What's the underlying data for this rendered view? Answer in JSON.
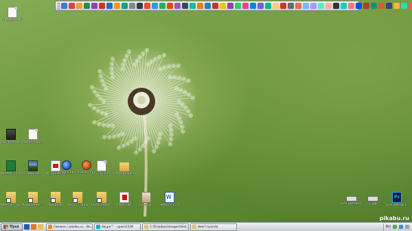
{
  "desktop": {
    "icons": [
      {
        "label": "Свежее.PNG",
        "type": "file"
      },
      {
        "label": "расписание...",
        "type": "dark"
      },
      {
        "label": "taglib-sharp.dll",
        "type": "file"
      },
      {
        "label": "ФОРМА 50 на 29.12.2013...",
        "type": "excel"
      },
      {
        "label": "5-авиFOX...",
        "type": "photo"
      },
      {
        "label": "do_12232.pdf",
        "type": "pdf"
      },
      {
        "label": "aravas.mp3",
        "type": "blue"
      },
      {
        "label": "aravas.mp3",
        "type": "orange"
      },
      {
        "label": "LC-7503-1...",
        "type": "file"
      },
      {
        "label": "cd example1",
        "type": "folder"
      },
      {
        "label": "Фиеста - Ярлык",
        "type": "shortcut"
      },
      {
        "label": "Коваленко - Ярлык",
        "type": "shortcut"
      },
      {
        "label": "Ковалев",
        "type": "shortcut"
      },
      {
        "label": "Vector - Ярлык",
        "type": "shortcut"
      },
      {
        "label": "Radio Player - Ярлык",
        "type": "shortcut"
      },
      {
        "label": "flash.swf",
        "type": "flash"
      },
      {
        "label": "Zoobook...",
        "type": "archive"
      },
      {
        "label": "Звери к Р... Новый.docx",
        "type": "word"
      },
      {
        "label": "Без имени-1.tif",
        "type": "tiny"
      },
      {
        "label": "1.jpg",
        "type": "tiny"
      },
      {
        "label": "Без имени-1.psd",
        "type": "ps"
      }
    ]
  },
  "launcher": {
    "icon_colors": [
      "#3a7bd5",
      "#d64541",
      "#e8a23a",
      "#2e8b57",
      "#8e44ad",
      "#c0392b",
      "#1f6dc4",
      "#f39c12",
      "#16a085",
      "#7f8c8d",
      "#2c3e50",
      "#e74c3c",
      "#3498db",
      "#27ae60",
      "#d35400",
      "#9b59b6",
      "#34495e",
      "#1abc9c",
      "#e67e22",
      "#2980b9",
      "#c0392b",
      "#f1c40f",
      "#8e44ad",
      "#2ecc71",
      "#e84393",
      "#0984e3",
      "#6c5ce7",
      "#00b894",
      "#fdcb6e",
      "#d63031",
      "#636e72",
      "#e17055",
      "#74b9ff",
      "#a29bfe",
      "#55efc4",
      "#fab1a0",
      "#2d3436",
      "#00cec9",
      "#ff7675",
      "#0652dd",
      "#b33939",
      "#218c74",
      "#cd6133",
      "#40407a",
      "#ffb142",
      "#33d9b2",
      "#ff5252"
    ]
  },
  "taskbar": {
    "start_label": "Пуск",
    "tasks": [
      {
        "label": "Свежее / pikabu.ru - Bo...",
        "icon_color": "#f58220"
      },
      {
        "label": "Skype™ - spam1239",
        "icon_color": "#00aff0"
      },
      {
        "label": "C:\\Dropbox\\images\\Vect...",
        "icon_color": "#e8c15a"
      },
      {
        "label": "deer'n'panda",
        "icon_color": "#e8c15a"
      }
    ],
    "language": "RU"
  },
  "watermark": "pikabu.ru"
}
